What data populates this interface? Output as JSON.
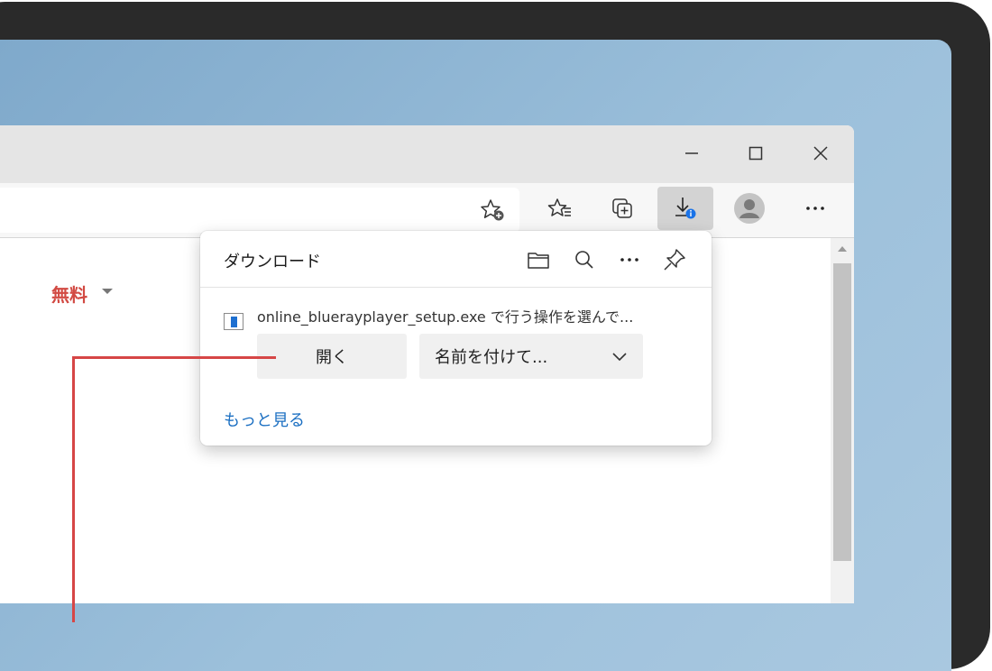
{
  "window": {
    "minimize_icon": "minimize-icon",
    "maximize_icon": "maximize-icon",
    "close_icon": "close-icon"
  },
  "toolbar": {
    "icons": [
      "add-favorite-icon",
      "favorites-icon",
      "collections-icon",
      "downloads-icon",
      "profile-icon",
      "more-icon"
    ],
    "downloads_badge_color": "#1a73e8"
  },
  "page": {
    "free_label": "無料"
  },
  "downloads_panel": {
    "title": "ダウンロード",
    "header_icons": [
      "folder-icon",
      "search-icon",
      "more-icon",
      "pin-icon"
    ],
    "item": {
      "file_text": "online_bluerayplayer_setup.exe で行う操作を選んで...",
      "open_button": "開く",
      "save_as_button": "名前を付けて..."
    },
    "see_more_link": "もっと見る"
  },
  "colors": {
    "accent_red": "#d24a43",
    "link_blue": "#1b6fc2",
    "callout_red": "#d64646"
  }
}
